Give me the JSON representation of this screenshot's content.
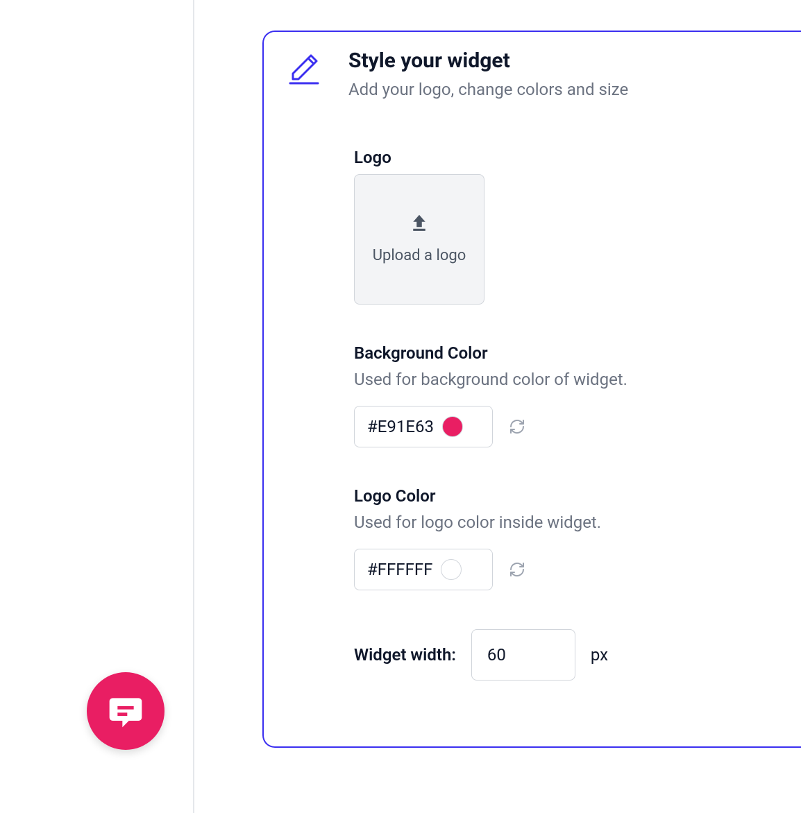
{
  "colors": {
    "accent": "#E91E63",
    "border_highlight": "#3b2ff0"
  },
  "header": {
    "title": "Style your widget",
    "subtitle": "Add your logo, change colors and size"
  },
  "logo": {
    "label": "Logo",
    "upload_text": "Upload a logo"
  },
  "background_color": {
    "label": "Background Color",
    "description": "Used for background color of widget.",
    "value": "#E91E63"
  },
  "logo_color": {
    "label": "Logo Color",
    "description": "Used for logo color inside widget.",
    "value": "#FFFFFF"
  },
  "widget_width": {
    "label": "Widget width:",
    "value": "60",
    "unit": "px"
  },
  "chat_fab": {
    "background": "#E91E63"
  }
}
